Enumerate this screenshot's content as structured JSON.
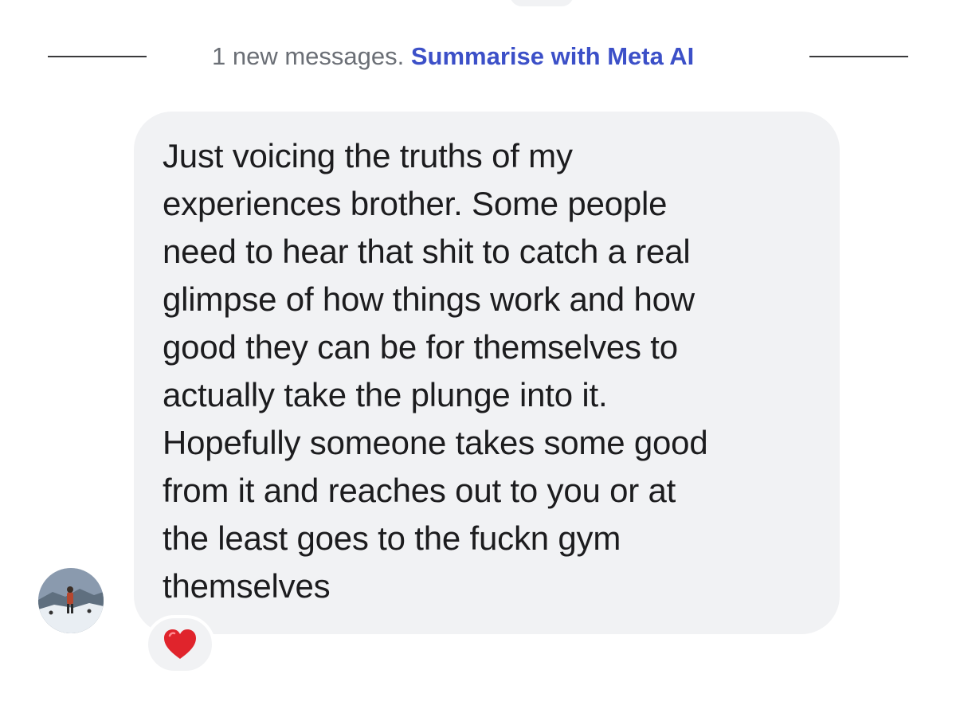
{
  "divider": {
    "new_messages_text": "1 new messages.",
    "summarise_link": "Summarise with Meta AI"
  },
  "message": {
    "text": "Just voicing the truths of my\nexperiences brother. Some people\nneed to hear that shit to catch a real\nglimpse of how things work and how\ngood they can be for themselves to\nactually take the plunge into it.\nHopefully someone takes some good\nfrom it and reaches out to you or at\nthe least goes to the fuckn gym\nthemselves",
    "reaction": "heart-icon"
  },
  "colors": {
    "link": "#3c50c8",
    "bubble": "#f1f2f4",
    "heart": "#e0242c"
  }
}
